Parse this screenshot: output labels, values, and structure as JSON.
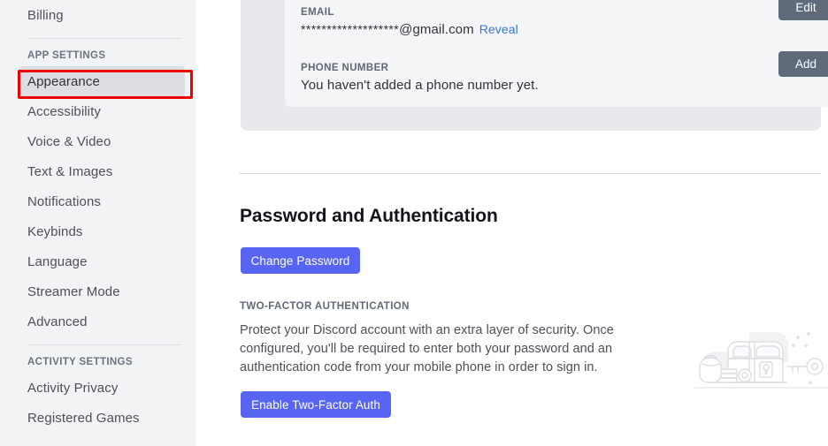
{
  "sidebar": {
    "top_items": [
      {
        "label": "Billing",
        "selected": false
      }
    ],
    "app_settings_header": "APP SETTINGS",
    "app_settings_items": [
      {
        "label": "Appearance",
        "selected": true
      },
      {
        "label": "Accessibility",
        "selected": false
      },
      {
        "label": "Voice & Video",
        "selected": false
      },
      {
        "label": "Text & Images",
        "selected": false
      },
      {
        "label": "Notifications",
        "selected": false
      },
      {
        "label": "Keybinds",
        "selected": false
      },
      {
        "label": "Language",
        "selected": false
      },
      {
        "label": "Streamer Mode",
        "selected": false
      },
      {
        "label": "Advanced",
        "selected": false
      }
    ],
    "activity_settings_header": "ACTIVITY SETTINGS",
    "activity_settings_items": [
      {
        "label": "Activity Privacy",
        "selected": false
      },
      {
        "label": "Registered Games",
        "selected": false
      }
    ]
  },
  "annotation": {
    "color": "#ee0000",
    "target": "Appearance"
  },
  "account": {
    "email": {
      "label": "EMAIL",
      "masked_value": "*******************",
      "domain": "@gmail.com",
      "reveal_label": "Reveal",
      "button_label": "Edit"
    },
    "phone": {
      "label": "PHONE NUMBER",
      "value": "You haven't added a phone number yet.",
      "button_label": "Add"
    }
  },
  "password_section": {
    "title": "Password and Authentication",
    "change_password_label": "Change Password",
    "two_factor_label": "TWO-FACTOR AUTHENTICATION",
    "two_factor_description": "Protect your Discord account with an extra layer of security. Once configured, you'll be required to enter both your password and an authentication code from your mobile phone in order to sign in.",
    "enable_two_factor_label": "Enable Two-Factor Auth"
  },
  "colors": {
    "blurple": "#5865f2",
    "grey_button": "#5f6b7a",
    "link": "#3a76d6",
    "sidebar_bg": "#f2f3f5",
    "selected_bg": "#dcdee3"
  }
}
